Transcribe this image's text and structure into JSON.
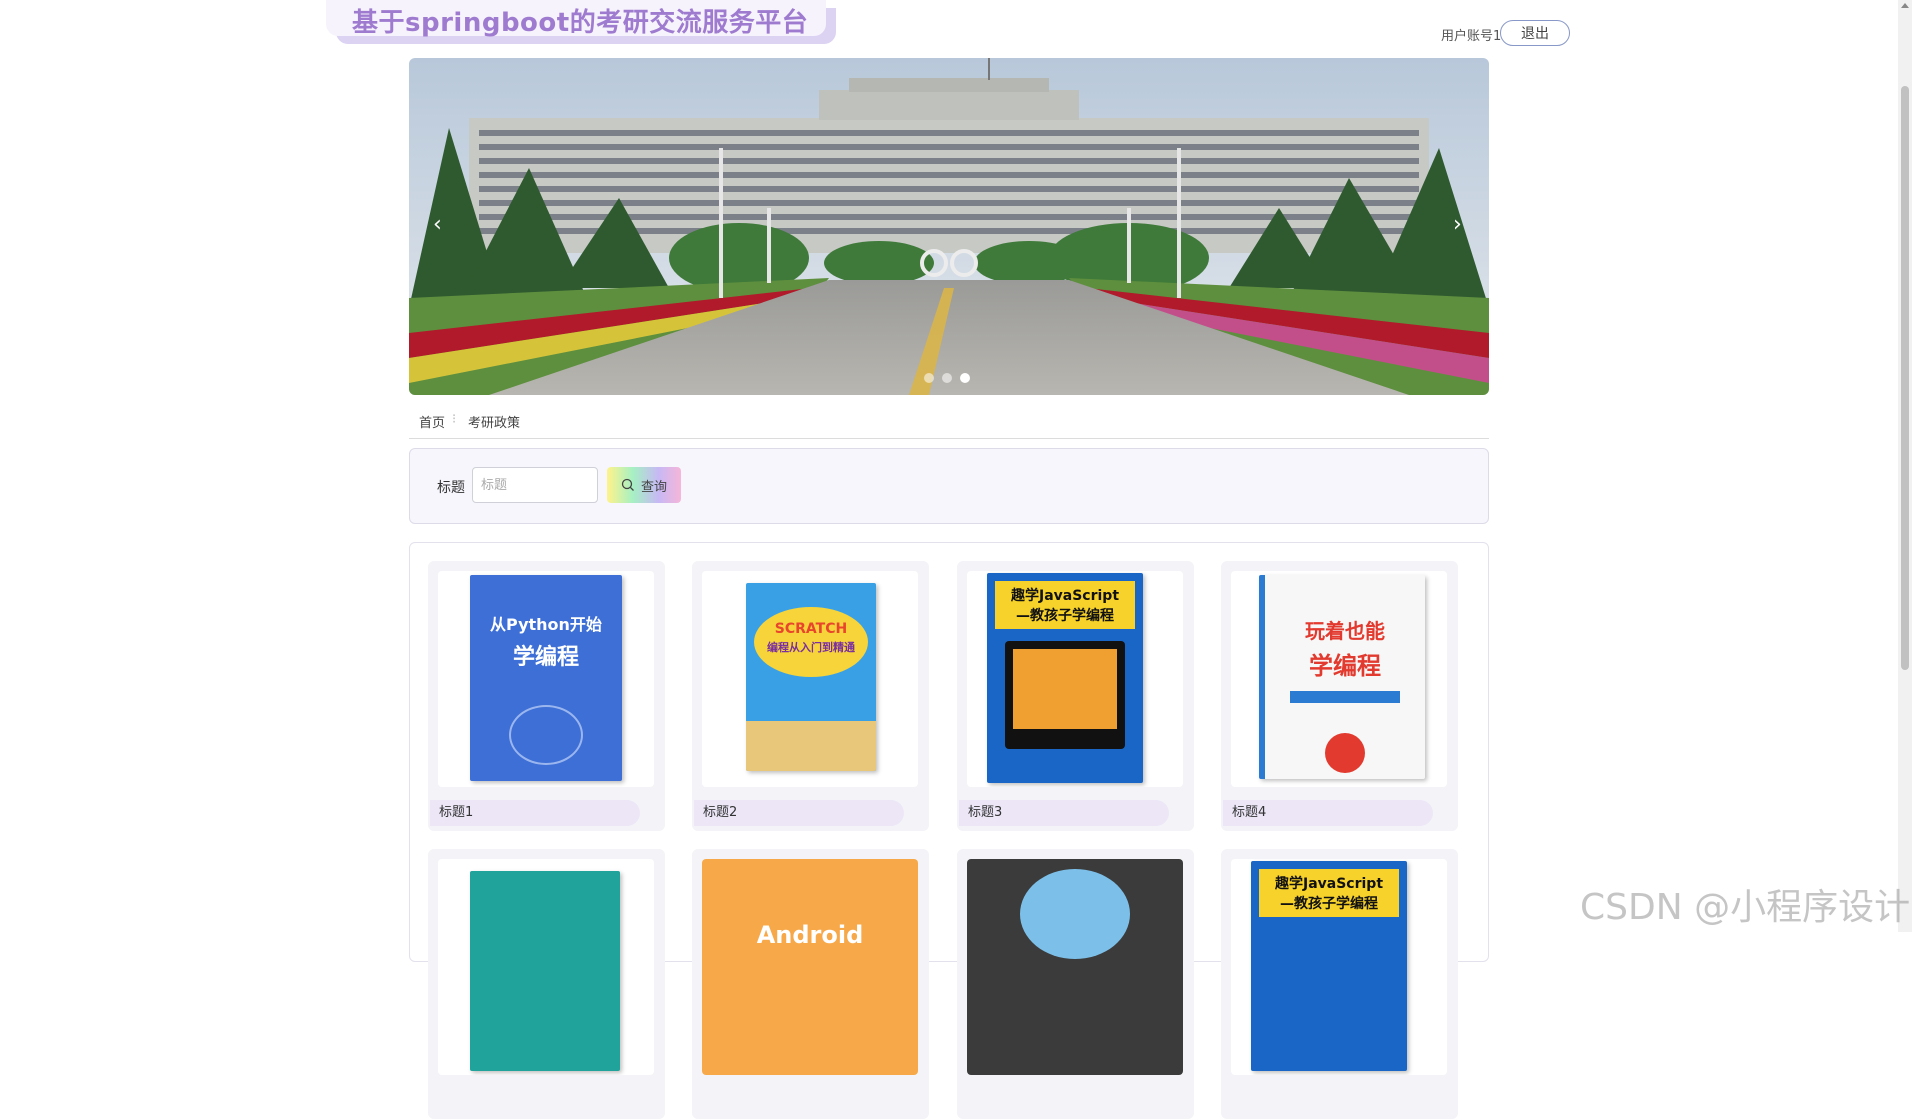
{
  "header": {
    "site_title": "基于springboot的考研交流服务平台",
    "user_label": "用户账号1",
    "logout_label": "退出"
  },
  "carousel": {
    "prev_icon": "chevron-left",
    "next_icon": "chevron-right",
    "slide_count": 3,
    "active_index": 3
  },
  "breadcrumb": {
    "home": "首页",
    "separator": "⁝",
    "current": "考研政策"
  },
  "search": {
    "label": "标题",
    "placeholder": "标题",
    "button_label": "查询",
    "button_icon": "search-icon"
  },
  "cards": [
    {
      "title": "标题1",
      "cover_text": "从Python开始学编程",
      "cover_color": "#3d6fd6"
    },
    {
      "title": "标题2",
      "cover_text": "SCRATCH编程从入门到精通",
      "cover_color": "#3aa0e6"
    },
    {
      "title": "标题3",
      "cover_text": "趣学JavaScript—教孩子学编程",
      "cover_color": "#1a66c6"
    },
    {
      "title": "标题4",
      "cover_text": "玩着也能学编程",
      "cover_color": "#f7f7f7"
    },
    {
      "title": "",
      "cover_text": "",
      "cover_color": "#1fa39a"
    },
    {
      "title": "",
      "cover_text": "Android",
      "cover_color": "#f7a94a"
    },
    {
      "title": "",
      "cover_text": "",
      "cover_color": "#3b3b3b"
    },
    {
      "title": "",
      "cover_text": "趣学JavaScript—教孩子学编程",
      "cover_color": "#1a66c6"
    }
  ],
  "watermark": "CSDN @小程序设计"
}
